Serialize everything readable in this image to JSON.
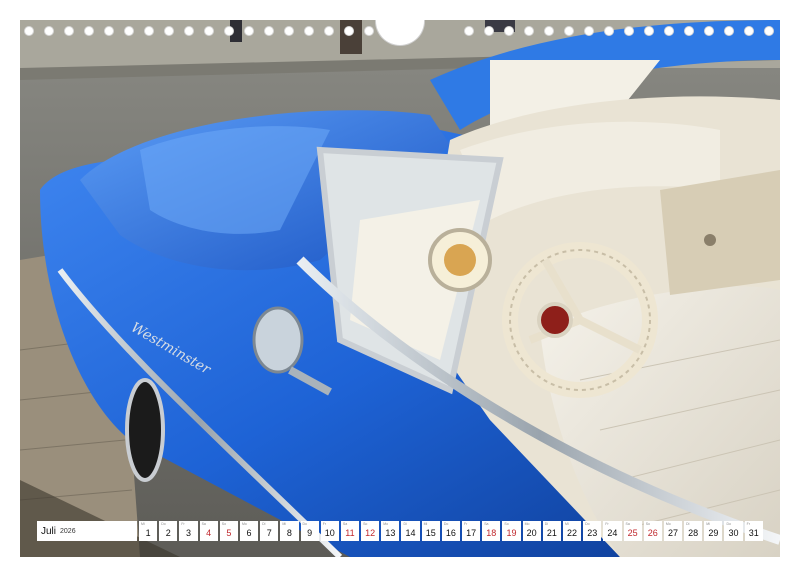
{
  "photo": {
    "subject": "blue-convertible-car",
    "fender_script": "Westminster"
  },
  "calendar": {
    "month": "Juli",
    "year": "2026",
    "days": [
      {
        "num": "1",
        "dn": "Mi",
        "weekend": false
      },
      {
        "num": "2",
        "dn": "Do",
        "weekend": false
      },
      {
        "num": "3",
        "dn": "Fr",
        "weekend": false
      },
      {
        "num": "4",
        "dn": "Sa",
        "weekend": true
      },
      {
        "num": "5",
        "dn": "So",
        "weekend": true
      },
      {
        "num": "6",
        "dn": "Mo",
        "weekend": false
      },
      {
        "num": "7",
        "dn": "Di",
        "weekend": false
      },
      {
        "num": "8",
        "dn": "Mi",
        "weekend": false
      },
      {
        "num": "9",
        "dn": "Do",
        "weekend": false
      },
      {
        "num": "10",
        "dn": "Fr",
        "weekend": false
      },
      {
        "num": "11",
        "dn": "Sa",
        "weekend": true
      },
      {
        "num": "12",
        "dn": "So",
        "weekend": true
      },
      {
        "num": "13",
        "dn": "Mo",
        "weekend": false
      },
      {
        "num": "14",
        "dn": "Di",
        "weekend": false
      },
      {
        "num": "15",
        "dn": "Mi",
        "weekend": false
      },
      {
        "num": "16",
        "dn": "Do",
        "weekend": false
      },
      {
        "num": "17",
        "dn": "Fr",
        "weekend": false
      },
      {
        "num": "18",
        "dn": "Sa",
        "weekend": true
      },
      {
        "num": "19",
        "dn": "So",
        "weekend": true
      },
      {
        "num": "20",
        "dn": "Mo",
        "weekend": false
      },
      {
        "num": "21",
        "dn": "Di",
        "weekend": false
      },
      {
        "num": "22",
        "dn": "Mi",
        "weekend": false
      },
      {
        "num": "23",
        "dn": "Do",
        "weekend": false
      },
      {
        "num": "24",
        "dn": "Fr",
        "weekend": false
      },
      {
        "num": "25",
        "dn": "Sa",
        "weekend": true
      },
      {
        "num": "26",
        "dn": "So",
        "weekend": true
      },
      {
        "num": "27",
        "dn": "Mo",
        "weekend": false
      },
      {
        "num": "28",
        "dn": "Di",
        "weekend": false
      },
      {
        "num": "29",
        "dn": "Mi",
        "weekend": false
      },
      {
        "num": "30",
        "dn": "Do",
        "weekend": false
      },
      {
        "num": "31",
        "dn": "Fr",
        "weekend": false
      }
    ]
  },
  "colors": {
    "car_blue": "#1e63d6",
    "car_blue_dark": "#0d3a91",
    "interior_cream": "#eee9dc",
    "pavement": "#6e6d68",
    "weekend_red": "#c0282d"
  }
}
